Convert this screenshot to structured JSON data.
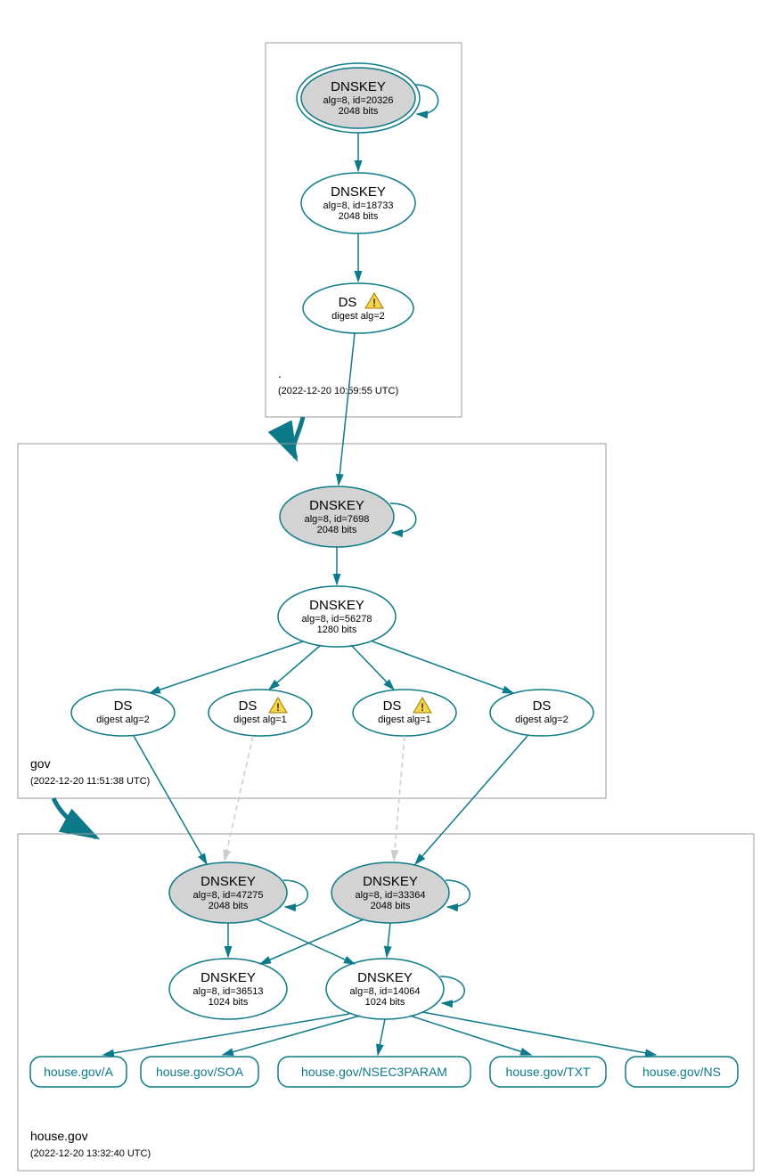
{
  "zones": {
    "root": {
      "label": ".",
      "timestamp": "(2022-12-20 10:59:55 UTC)"
    },
    "gov": {
      "label": "gov",
      "timestamp": "(2022-12-20 11:51:38 UTC)"
    },
    "house": {
      "label": "house.gov",
      "timestamp": "(2022-12-20 13:32:40 UTC)"
    }
  },
  "nodes": {
    "root_ksk": {
      "title": "DNSKEY",
      "sub1": "alg=8, id=20326",
      "sub2": "2048 bits"
    },
    "root_zsk": {
      "title": "DNSKEY",
      "sub1": "alg=8, id=18733",
      "sub2": "2048 bits"
    },
    "root_ds": {
      "title": "DS",
      "sub1": "digest alg=2"
    },
    "gov_ksk": {
      "title": "DNSKEY",
      "sub1": "alg=8, id=7698",
      "sub2": "2048 bits"
    },
    "gov_zsk": {
      "title": "DNSKEY",
      "sub1": "alg=8, id=56278",
      "sub2": "1280 bits"
    },
    "gov_ds1": {
      "title": "DS",
      "sub1": "digest alg=2"
    },
    "gov_ds2": {
      "title": "DS",
      "sub1": "digest alg=1"
    },
    "gov_ds3": {
      "title": "DS",
      "sub1": "digest alg=1"
    },
    "gov_ds4": {
      "title": "DS",
      "sub1": "digest alg=2"
    },
    "house_ksk1": {
      "title": "DNSKEY",
      "sub1": "alg=8, id=47275",
      "sub2": "2048 bits"
    },
    "house_ksk2": {
      "title": "DNSKEY",
      "sub1": "alg=8, id=33364",
      "sub2": "2048 bits"
    },
    "house_zsk1": {
      "title": "DNSKEY",
      "sub1": "alg=8, id=36513",
      "sub2": "1024 bits"
    },
    "house_zsk2": {
      "title": "DNSKEY",
      "sub1": "alg=8, id=14064",
      "sub2": "1024 bits"
    }
  },
  "rrsets": {
    "a": "house.gov/A",
    "soa": "house.gov/SOA",
    "n3p": "house.gov/NSEC3PARAM",
    "txt": "house.gov/TXT",
    "ns": "house.gov/NS"
  }
}
